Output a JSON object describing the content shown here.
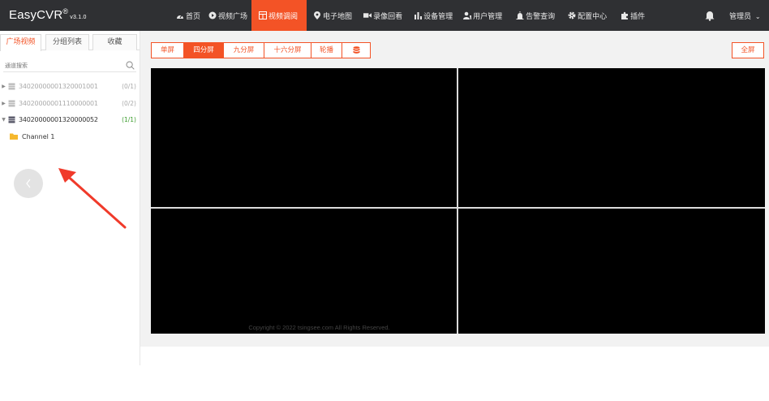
{
  "app": {
    "brand": "EasyCVR",
    "brand_mark": "®",
    "version": "v3.1.0"
  },
  "nav": {
    "items": [
      {
        "label": "首页",
        "icon": "dashboard-icon"
      },
      {
        "label": "视频广场",
        "icon": "play-circle-icon"
      },
      {
        "label": "视频调阅",
        "icon": "video-grid-icon",
        "active": true
      },
      {
        "label": "电子地图",
        "icon": "map-pin-icon"
      },
      {
        "label": "录像回看",
        "icon": "video-camera-icon"
      },
      {
        "label": "设备管理",
        "icon": "bar-chart-icon"
      },
      {
        "label": "用户管理",
        "icon": "users-icon"
      },
      {
        "label": "告警查询",
        "icon": "alarm-icon"
      },
      {
        "label": "配置中心",
        "icon": "gear-icon"
      },
      {
        "label": "插件",
        "icon": "puzzle-icon"
      }
    ],
    "bell_icon": "bell-icon",
    "user_label": "管理员"
  },
  "sidebar": {
    "tabs": [
      {
        "label": "广场视频",
        "active": true
      },
      {
        "label": "分组列表"
      },
      {
        "label": "收藏"
      }
    ],
    "search": {
      "placeholder": "通道搜索",
      "icon": "search-icon"
    },
    "devices": [
      {
        "id": "34020000001320001001",
        "count": "(0/1)",
        "online": false,
        "expanded": false
      },
      {
        "id": "34020000001110000001",
        "count": "(0/2)",
        "online": false,
        "expanded": false
      },
      {
        "id": "34020000001320000052",
        "count": "(1/1)",
        "online": true,
        "expanded": true
      }
    ],
    "channel": {
      "label": "Channel 1",
      "icon": "folder-icon"
    }
  },
  "toolbar": {
    "buttons": [
      {
        "label": "单屏"
      },
      {
        "label": "四分屏",
        "active": true
      },
      {
        "label": "九分屏"
      },
      {
        "label": "十六分屏"
      },
      {
        "label": "轮播"
      },
      {
        "label": "",
        "icon": "database-icon"
      }
    ],
    "fullscreen_label": "全屏"
  },
  "footer": {
    "copyright": "Copyright © 2022 tsingsee.com All Rights Reserved."
  },
  "colors": {
    "accent": "#f35326",
    "topbar": "#2f3033",
    "online": "#3c9d2e",
    "annotation_arrow": "#f03a2a"
  }
}
